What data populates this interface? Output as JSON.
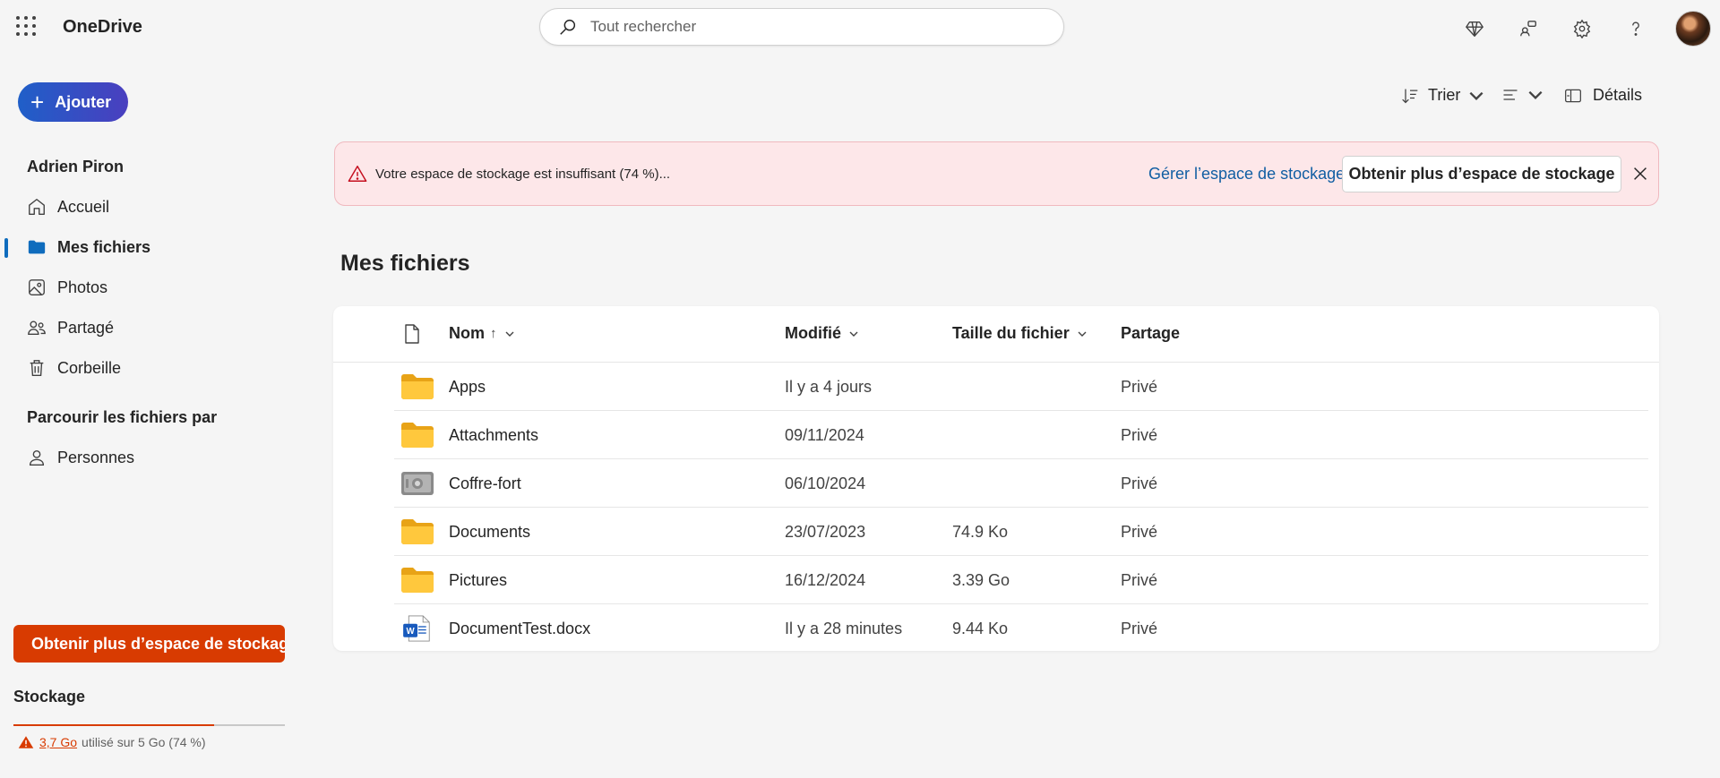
{
  "app": {
    "title": "OneDrive"
  },
  "search": {
    "placeholder": "Tout rechercher"
  },
  "header_icons": [
    "premium-diamond-icon",
    "share-people-icon",
    "settings-gear-icon",
    "help-question-icon",
    "user-avatar"
  ],
  "sidebar": {
    "add_label": "Ajouter",
    "user_name": "Adrien Piron",
    "items": [
      {
        "label": "Accueil",
        "icon": "home-icon"
      },
      {
        "label": "Mes fichiers",
        "icon": "folder-icon",
        "active": true
      },
      {
        "label": "Photos",
        "icon": "photo-icon"
      },
      {
        "label": "Partagé",
        "icon": "people-icon"
      },
      {
        "label": "Corbeille",
        "icon": "trash-icon"
      }
    ],
    "browse_title": "Parcourir les fichiers par",
    "browse_items": [
      {
        "label": "Personnes",
        "icon": "person-icon"
      }
    ],
    "storage_cta": "Obtenir plus d’espace de stockage",
    "storage_title": "Stockage",
    "storage_used": "3,7 Go",
    "storage_rest": "utilisé sur 5 Go (74 %)",
    "storage_percent": 74
  },
  "toolbar": {
    "sort_label": "Trier",
    "details_label": "Détails"
  },
  "banner": {
    "message": "Votre espace de stockage est insuffisant (74 %)...",
    "link": "Gérer l’espace de stockage",
    "button": "Obtenir plus d’espace de stockage"
  },
  "page": {
    "title": "Mes fichiers"
  },
  "table": {
    "columns": {
      "name": "Nom",
      "name_sort": "↑",
      "modified": "Modifié",
      "size": "Taille du fichier",
      "sharing": "Partage"
    },
    "rows": [
      {
        "type": "folder",
        "name": "Apps",
        "modified": "Il y a 4 jours",
        "size": "",
        "sharing": "Privé"
      },
      {
        "type": "folder",
        "name": "Attachments",
        "modified": "09/11/2024",
        "size": "",
        "sharing": "Privé"
      },
      {
        "type": "vault",
        "name": "Coffre-fort",
        "modified": "06/10/2024",
        "size": "",
        "sharing": "Privé"
      },
      {
        "type": "folder",
        "name": "Documents",
        "modified": "23/07/2023",
        "size": "74.9 Ko",
        "sharing": "Privé"
      },
      {
        "type": "folder",
        "name": "Pictures",
        "modified": "16/12/2024",
        "size": "3.39 Go",
        "sharing": "Privé"
      },
      {
        "type": "word",
        "name": "DocumentTest.docx",
        "modified": "Il y a 28 minutes",
        "size": "9.44 Ko",
        "sharing": "Privé"
      }
    ]
  },
  "colors": {
    "accent": "#0f6cbd",
    "warning": "#d83b01",
    "banner_bg": "#fde7e9",
    "folder": "#f6c244"
  }
}
